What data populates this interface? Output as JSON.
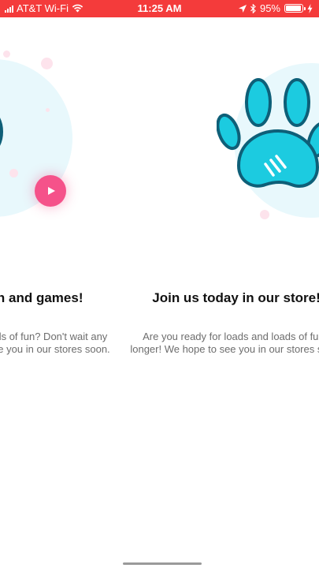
{
  "status_bar": {
    "carrier": "AT&T Wi-Fi",
    "time": "11:25 AM",
    "battery": "95%",
    "battery_level": 0.95
  },
  "slides": [
    {
      "title": "Have fun and games!",
      "body_line1": "Are you ready for loads of fun? Don't wait any",
      "body_line2": "longer! We hope to see you in our stores soon."
    },
    {
      "title": "Join us today in our store!",
      "body_line1": "Are you ready for loads and loads of fun?",
      "body_line2": "longer! We hope to see you in our stores soon."
    }
  ],
  "colors": {
    "status_bar": "#f43b3b",
    "paw": "#1ccbe0",
    "paw_outline": "#0e5f78",
    "play_button": "#f5528a"
  }
}
